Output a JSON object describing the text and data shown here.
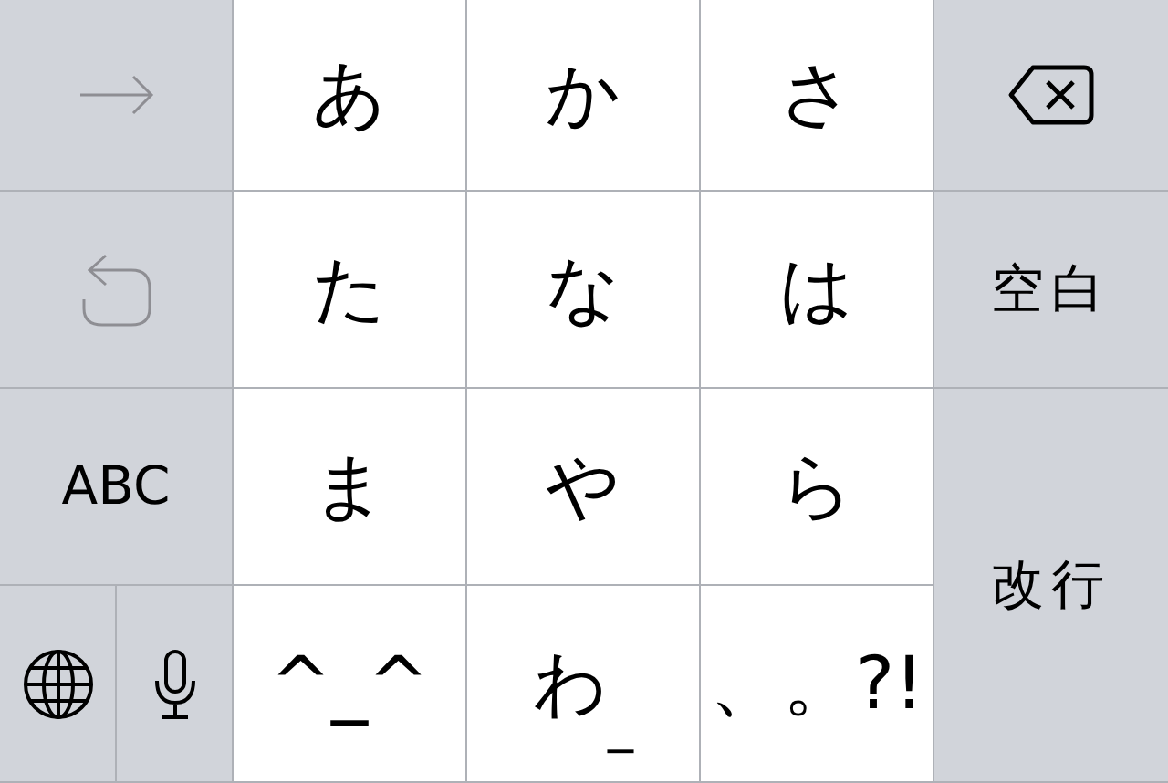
{
  "left_keys": [
    {
      "kind": "arrow",
      "disabled": true
    },
    {
      "kind": "undo",
      "disabled": true
    },
    {
      "kind": "label",
      "label": "ABC"
    }
  ],
  "kana_keys": [
    {
      "label": "あ"
    },
    {
      "label": "か"
    },
    {
      "label": "さ"
    },
    {
      "label": "た"
    },
    {
      "label": "な"
    },
    {
      "label": "は"
    },
    {
      "label": "ま"
    },
    {
      "label": "や"
    },
    {
      "label": "ら"
    },
    {
      "label": "^_^"
    },
    {
      "label": "わ",
      "sub": "_"
    },
    {
      "label": "、。?!"
    }
  ],
  "right_keys": [
    {
      "kind": "delete"
    },
    {
      "kind": "label",
      "label": "空白"
    },
    {
      "kind": "label",
      "label": "改行"
    }
  ]
}
